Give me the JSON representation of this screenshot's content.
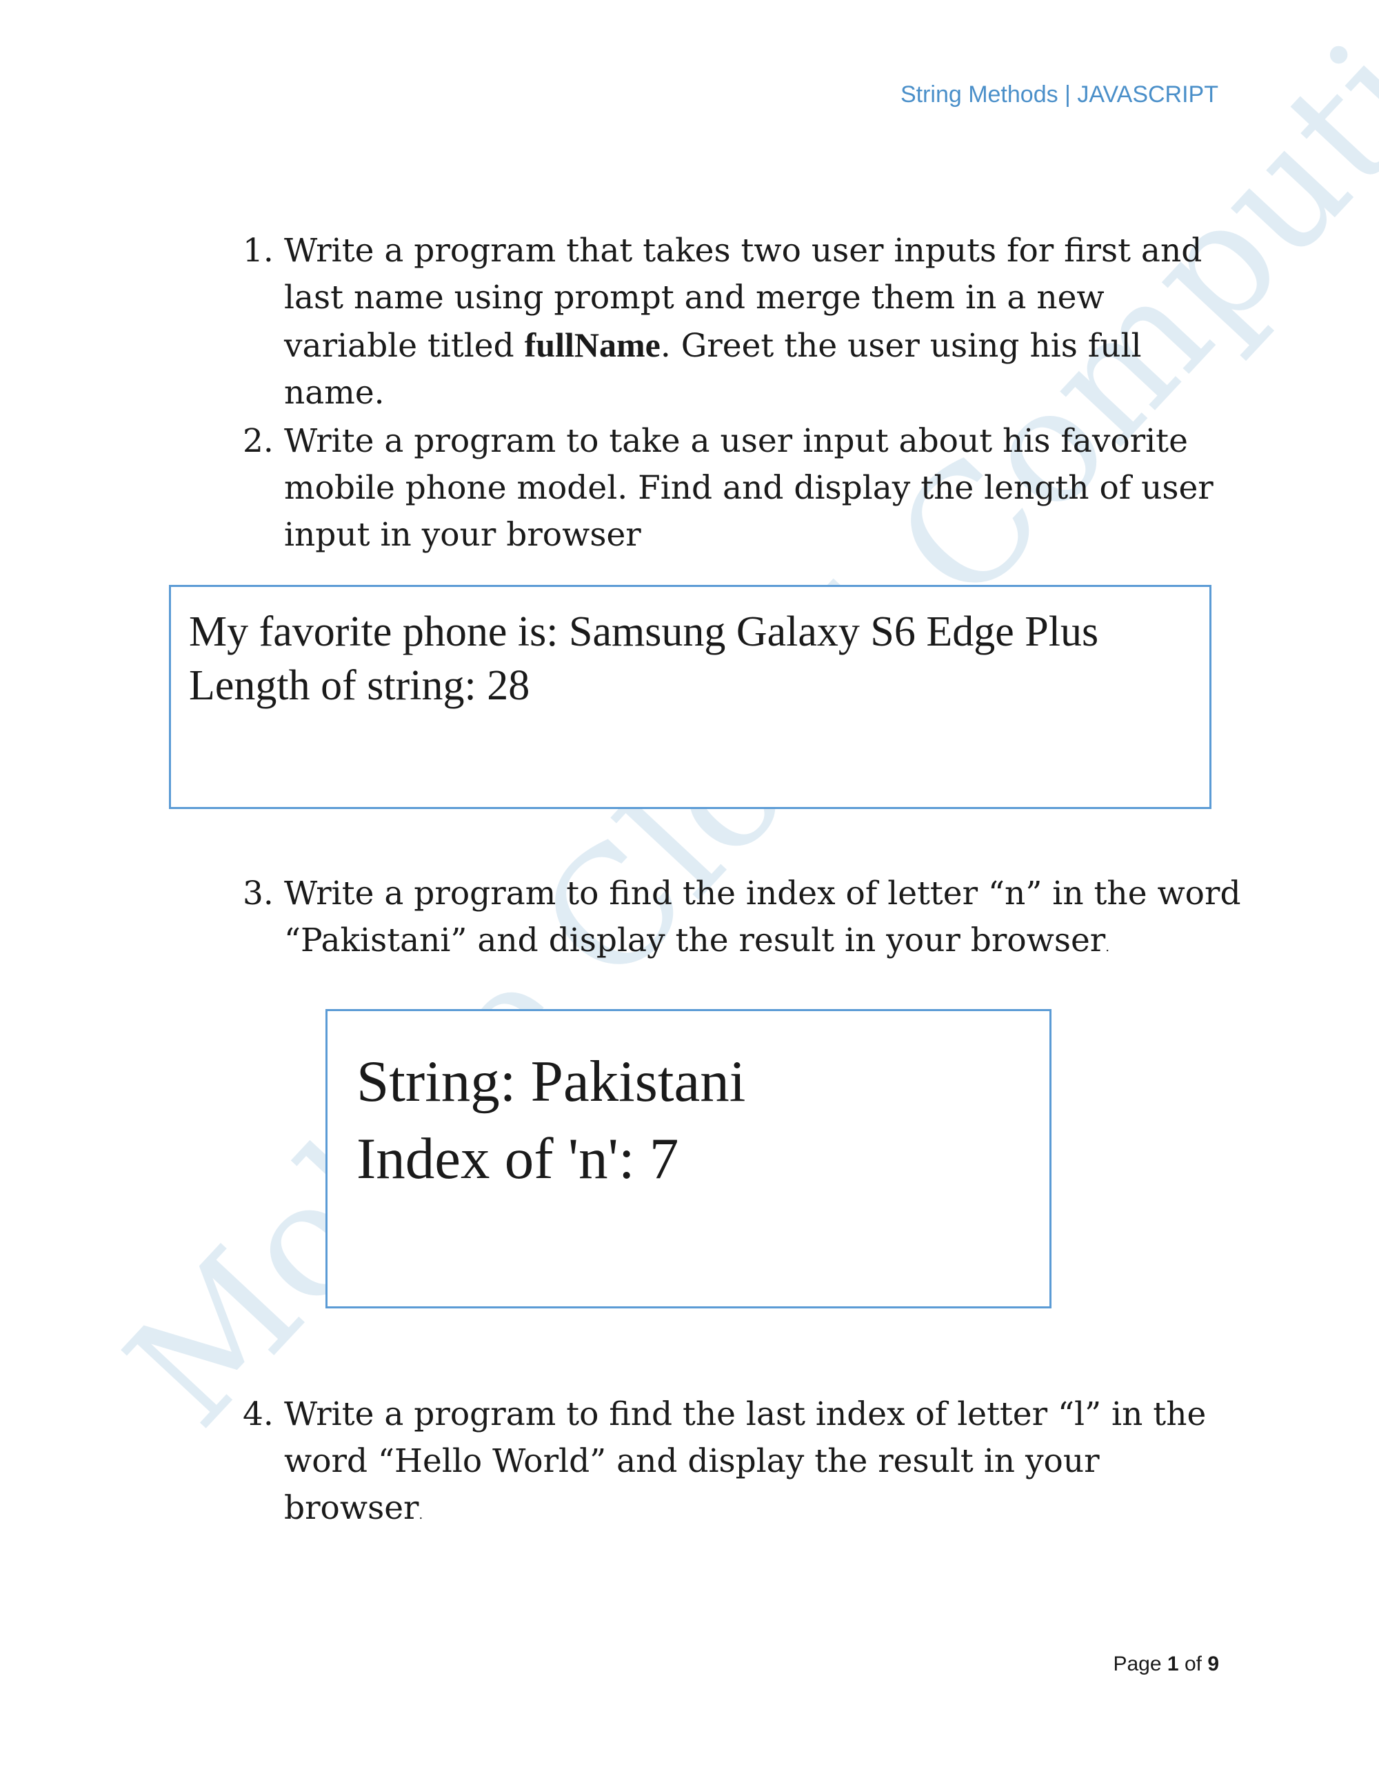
{
  "header": {
    "title": "String Methods | JAVASCRIPT"
  },
  "watermark": {
    "text": "Mobile Cloud Computing"
  },
  "questions": [
    {
      "number": "1.",
      "text_before": "Write a program that takes two user inputs for first and last name using prompt and merge them in a new variable titled ",
      "bold": "fullName",
      "text_after": ". Greet the user using his full name."
    },
    {
      "number": "2.",
      "text": "Write a program to take a user input about his favorite mobile phone model. Find and display the length of user input in your browser"
    },
    {
      "number": "3.",
      "text": "Write a program to find the index of letter “n” in the word “Pakistani” and display the result in your browser",
      "trailing": "."
    },
    {
      "number": "4.",
      "text": "Write a program to find the last index of letter “l” in the word “Hello World” and display the result in your browser",
      "trailing": "."
    }
  ],
  "output_boxes": [
    {
      "lines": [
        "My favorite phone is: Samsung Galaxy S6 Edge Plus",
        "Length of string: 28"
      ]
    },
    {
      "lines": [
        "String: Pakistani",
        "Index of 'n': 7"
      ]
    }
  ],
  "footer": {
    "page_label": "Page",
    "current_page": "1",
    "of_label": "of",
    "total_pages": "9"
  },
  "colors": {
    "header_text": "#4a8fc9",
    "box_border": "#5b9bd5",
    "watermark": "#d6e6f1",
    "body_text": "#1a1a1a"
  }
}
